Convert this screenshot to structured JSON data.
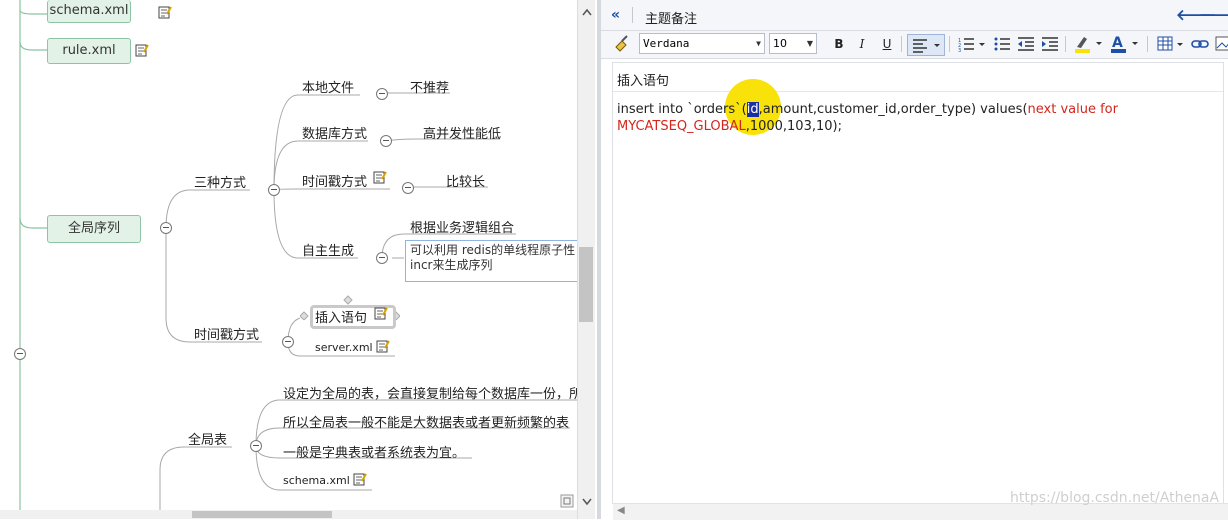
{
  "mindmap": {
    "topics": {
      "schema_xml": "schema.xml",
      "rule_xml": "rule.xml",
      "global_sequence": "全局序列"
    },
    "three_methods": "三种方式",
    "local_file": "本地文件",
    "not_recommended": "不推荐",
    "database_method": "数据库方式",
    "high_concurrency": "高并发性能低",
    "timestamp_method": "时间戳方式",
    "longer": "比较长",
    "self_generated": "自主生成",
    "business_logic_combo": "根据业务逻辑组合",
    "redis_note_line1": "可以利用 redis的单线程原子性",
    "redis_note_line2": "incr来生成序列",
    "timestamp_method_2": "时间戳方式",
    "insert_statement": "插入语句",
    "server_xml": "server.xml",
    "global_table": "全局表",
    "global_table_note1": "设定为全局的表，会直接复制给每个数据库一份，所",
    "global_table_note2": "所以全局表一般不能是大数据表或者更新频繁的表",
    "global_table_note3": "一般是字典表或者系统表为宜。",
    "schema_xml_2": "schema.xml"
  },
  "notes_panel": {
    "collapse_icon": "«",
    "title": "主题备注",
    "nav_back": "🡐",
    "nav_forward": "🡒",
    "toolbar": {
      "font": "Verdana",
      "size": "10",
      "bold": "B",
      "italic": "I",
      "underline": "U"
    },
    "editor": {
      "heading": "插入语句",
      "code_pre": "insert into `orders`(",
      "code_selected": "id",
      "code_mid": ",amount,customer_id,order_type) values(",
      "code_red1": "next value for",
      "code_red2": "MYCATSEQ_GLOBAL",
      "code_post": ",1000,103,10);"
    }
  },
  "watermark": "https://blog.csdn.net/AthenaA",
  "colors": {
    "topic_fill": "#e3f2e7",
    "topic_border": "#8dc5a4",
    "keyword_red": "#d2271d",
    "selection_blue": "#1a2fa4",
    "highlight_yellow": "#f8e20a",
    "nav_blue": "#1e4fa6"
  }
}
